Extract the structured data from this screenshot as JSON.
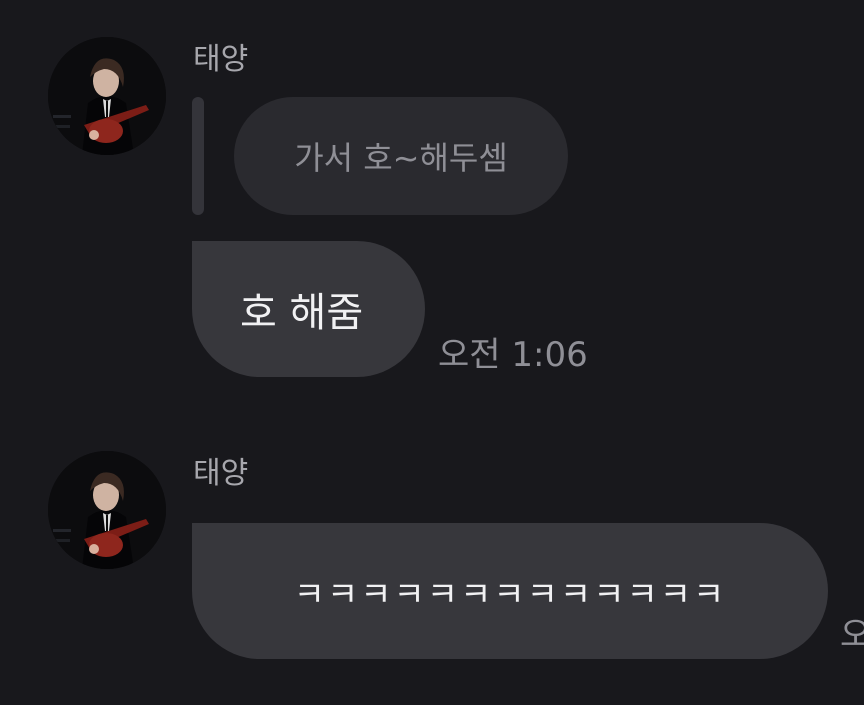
{
  "chat": {
    "groups": [
      {
        "sender": "태양",
        "avatar": "profile-photo",
        "reply_quote": "가서 호~해두셈",
        "message": "호 해줌",
        "time": "오전 1:06"
      },
      {
        "sender": "태양",
        "avatar": "profile-photo",
        "message": "ㅋㅋㅋㅋㅋㅋㅋㅋㅋㅋㅋㅋㅋ",
        "time": "오"
      }
    ]
  },
  "colors": {
    "background": "#18181c",
    "bubble": "#37373c",
    "reply_bubble": "#2a2a2f",
    "sender_text": "#a7a7ad",
    "timestamp_text": "#8f8f96"
  }
}
